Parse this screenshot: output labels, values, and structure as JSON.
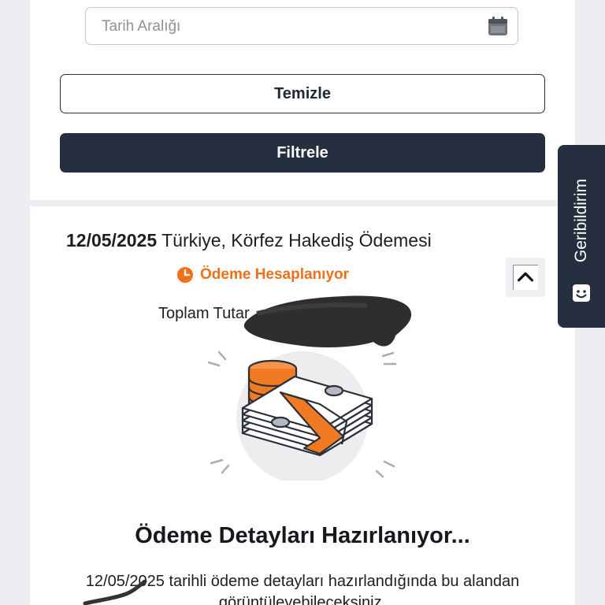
{
  "filters": {
    "date_range_placeholder": "Tarih Aralığı",
    "date_range_value": "",
    "clear_label": "Temizle",
    "filter_label": "Filtrele",
    "calendar_icon": "calendar-icon"
  },
  "payment": {
    "date": "12/05/2025",
    "title": "Türkiye, Körfez Hakediş Ödemesi",
    "status": "Ödeme Hesaplanıyor",
    "status_icon": "clock-icon",
    "status_color": "#f0701a",
    "total_label": "Toplam Tutar",
    "collapse_icon": "chevron-up-icon",
    "illustration": "money-stack-illustration",
    "details_heading": "Ödeme Detayları Hazırlanıyor...",
    "details_description": "12/05/2025 tarihli ödeme detayları hazırlandığında bu alandan görüntüleyebileceksiniz."
  },
  "feedback": {
    "label": "Geribildirim",
    "icon": "smile-icon"
  },
  "colors": {
    "primary_dark": "#262f40",
    "accent_orange": "#f0701a",
    "background": "#eceef2"
  }
}
